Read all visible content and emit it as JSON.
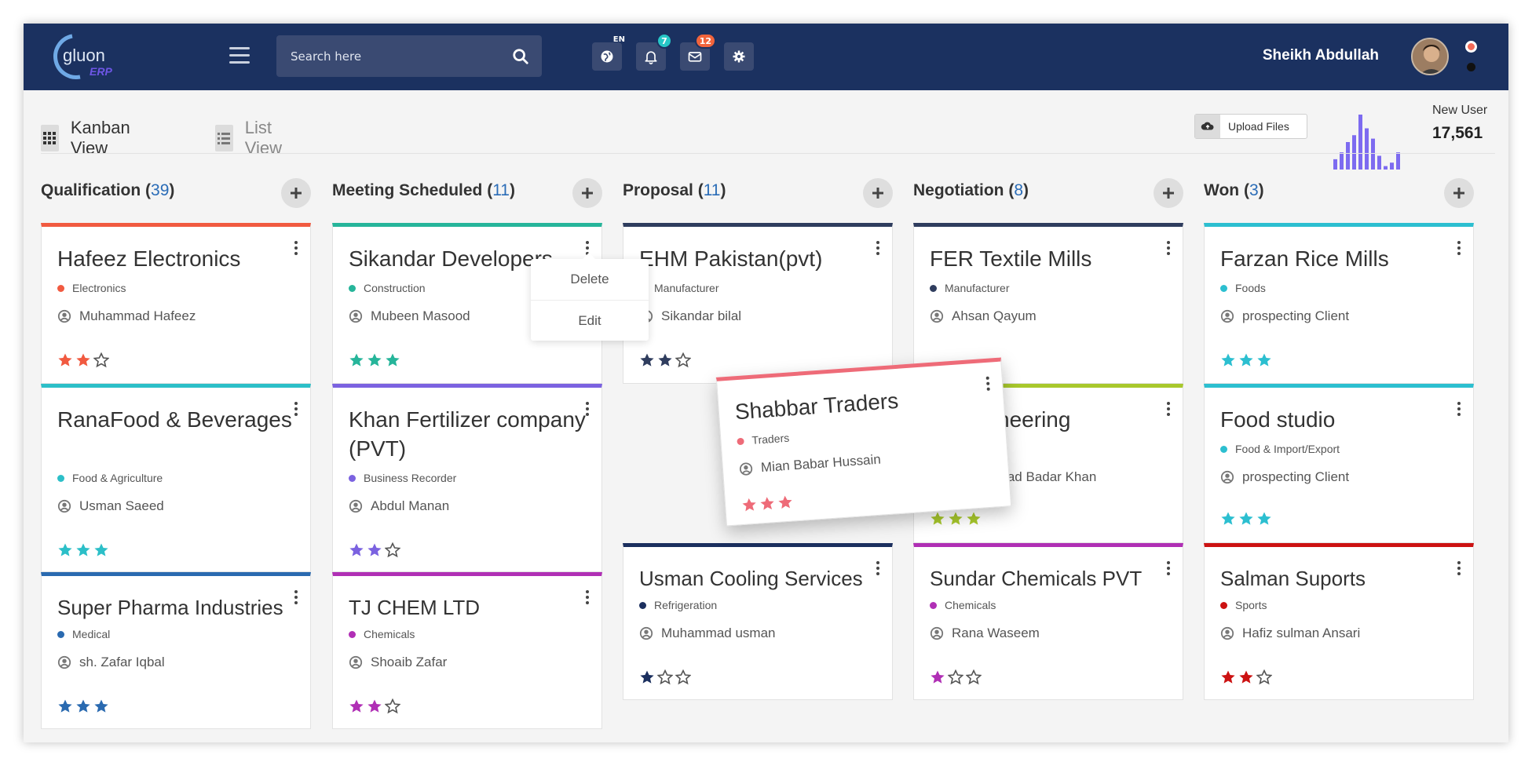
{
  "brand": {
    "name": "gluon",
    "sub": "ERP"
  },
  "search": {
    "placeholder": "Search here"
  },
  "topbar": {
    "lang": "EN",
    "notif_count": "7",
    "mail_count": "12",
    "username": "Sheikh Abdullah",
    "notif_badge_color": "#26c6c6",
    "mail_badge_color": "#f1643c"
  },
  "views": {
    "kanban": "Kanban View",
    "list": "List View"
  },
  "upload": {
    "label": "Upload Files"
  },
  "stats": {
    "label": "New User",
    "value": "17,561",
    "bars": [
      3,
      5,
      8,
      10,
      16,
      12,
      9,
      4,
      1,
      2,
      5
    ]
  },
  "columns": [
    {
      "title": "Qualification",
      "count": "39"
    },
    {
      "title": "Meeting Scheduled",
      "count": "11"
    },
    {
      "title": "Proposal",
      "count": "11"
    },
    {
      "title": "Negotiation",
      "count": "8"
    },
    {
      "title": "Won",
      "count": "3"
    }
  ],
  "cards": {
    "c1": {
      "title": "Hafeez Electronics",
      "category": "Electronics",
      "person": "Muhammad Hafeez",
      "rating": 2,
      "color": "#f15a40"
    },
    "c2": {
      "title": "RanaFood & Beverages",
      "category": "Food & Agriculture",
      "person": "Usman Saeed",
      "rating": 3,
      "color": "#2cbfc8"
    },
    "c3": {
      "title": "Super Pharma Industries",
      "category": "Medical",
      "person": "sh. Zafar Iqbal",
      "rating": 3,
      "color": "#2a6ab0"
    },
    "c4": {
      "title": "Sikandar Developers",
      "category": "Construction",
      "person": "Mubeen Masood",
      "rating": 3,
      "color": "#26b59a"
    },
    "c5": {
      "title": "Khan Fertilizer company (PVT)",
      "category": "Business Recorder",
      "person": "Abdul Manan",
      "rating": 2,
      "color": "#7b62e0"
    },
    "c6": {
      "title": "TJ CHEM LTD",
      "category": "Chemicals",
      "person": "Shoaib Zafar",
      "rating": 2,
      "color": "#b02fb5"
    },
    "c7": {
      "title": "EHM Pakistan(pvt)",
      "category": "Manufacturer",
      "person": "Sikandar bilal",
      "rating": 2,
      "color": "#2f3d5e"
    },
    "c8": {
      "title": "Usman Cooling Services",
      "category": "Refrigeration",
      "person": "Muhammad usman",
      "rating": 1,
      "color": "#1b2f5e"
    },
    "c9": {
      "title": "FER Textile Mills",
      "category": "Manufacturer",
      "person": "Ahsan Qayum",
      "rating": 0,
      "color": "#2f3d5e"
    },
    "c10": {
      "title": "Engineering",
      "category": "",
      "person": "Muhammad Badar Khan",
      "rating": 3,
      "color": "#a8c82c"
    },
    "c11": {
      "title": "Sundar Chemicals PVT",
      "category": "Chemicals",
      "person": "Rana Waseem",
      "rating": 1,
      "color": "#b02fb5"
    },
    "c12": {
      "title": "Farzan Rice Mills",
      "category": "Foods",
      "person": "prospecting Client",
      "rating": 3,
      "color": "#2cbfd0"
    },
    "c13": {
      "title": "Food studio",
      "category": "Food & Import/Export",
      "person": "prospecting Client",
      "rating": 3,
      "color": "#2cbfd0"
    },
    "c14": {
      "title": "Salman Suports",
      "category": "Sports",
      "person": "Hafiz sulman Ansari",
      "rating": 2,
      "color": "#cc1212"
    },
    "drag": {
      "title": "Shabbar Traders",
      "category": "Traders",
      "person": "Mian Babar Hussain",
      "rating": 3,
      "color": "#ee6b78"
    }
  },
  "popup": {
    "delete": "Delete",
    "edit": "Edit"
  }
}
